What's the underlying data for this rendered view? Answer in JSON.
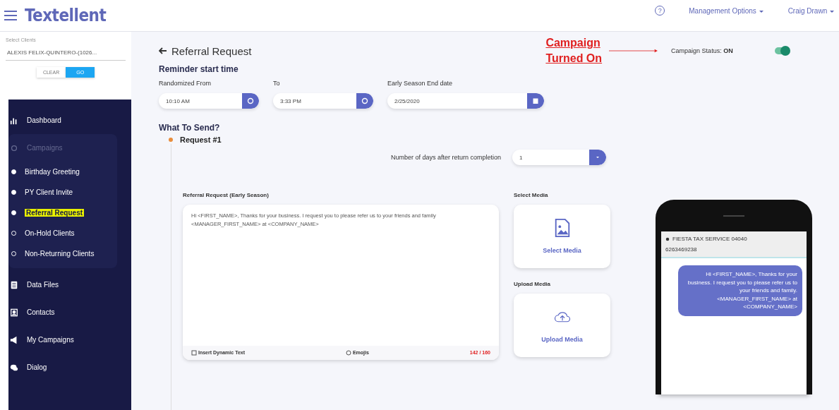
{
  "header": {
    "logo": "Textellent",
    "help": "?",
    "menus": [
      {
        "label": "Management Options"
      },
      {
        "label": "Craig Drawn"
      }
    ]
  },
  "sidebar": {
    "client_label": "Select Clients",
    "client_value": "ALEXIS FELIX-QUINTERO-(1026...",
    "buttons": [
      {
        "label": "CLEAR",
        "kind": "plain"
      },
      {
        "label": "GO",
        "kind": "primary"
      }
    ],
    "items": [
      {
        "label": "Dashboard",
        "kind": "nav",
        "selected": false
      },
      {
        "label": "Campaigns",
        "kind": "group",
        "selected": false,
        "children": [
          {
            "label": "Birthday Greeting",
            "on": true,
            "selected": false
          },
          {
            "label": "PY Client Invite",
            "on": true,
            "selected": false
          },
          {
            "label": "Referral Request",
            "on": true,
            "selected": true
          },
          {
            "label": "On-Hold Clients",
            "on": false,
            "selected": false
          },
          {
            "label": "Non-Returning Clients",
            "on": false,
            "selected": false
          }
        ]
      },
      {
        "label": "Data Files",
        "kind": "nav",
        "selected": false
      },
      {
        "label": "Contacts",
        "kind": "nav",
        "selected": false
      },
      {
        "label": "My Campaigns",
        "kind": "nav",
        "selected": false
      },
      {
        "label": "Dialog",
        "kind": "nav",
        "selected": false
      }
    ]
  },
  "page": {
    "title": "Referral Request",
    "annotation": [
      "Campaign",
      "Turned On"
    ],
    "status_label": "Campaign Status:",
    "status_value": "ON",
    "status_on": true
  },
  "reminder": {
    "heading": "Reminder start time",
    "fields": [
      {
        "label": "Randomized From",
        "value": "10:10 AM",
        "kind": "time"
      },
      {
        "label": "To",
        "value": "3:33 PM",
        "kind": "time"
      },
      {
        "label": "Early Season End date",
        "value": "2/25/2020",
        "kind": "date"
      }
    ]
  },
  "send": {
    "heading": "What To Send?",
    "request": "Request #1",
    "days_label": "Number of days after return completion",
    "days_value": "1",
    "message_label": "Referral Request (Early Season)",
    "message": "Hi <FIRST_NAME>, Thanks for your business. I request you to please refer us to your friends and family <MANAGER_FIRST_NAME> at <COMPANY_NAME>",
    "insert": "Insert Dynamic Text",
    "emojis": "Emojis",
    "count": "142 / 160",
    "media": [
      {
        "label": "Select Media",
        "button": "Select Media",
        "kind": "image"
      },
      {
        "label": "Upload Media",
        "button": "Upload Media",
        "kind": "upload"
      }
    ]
  },
  "preview": {
    "sender": "FIESTA TAX SERVICE 04040",
    "number": "6263469238",
    "bubble": "Hi <FIRST_NAME>, Thanks for your business. I request you to please refer us to your friends and family. <MANAGER_FIRST_NAME> at <COMPANY_NAME>"
  }
}
